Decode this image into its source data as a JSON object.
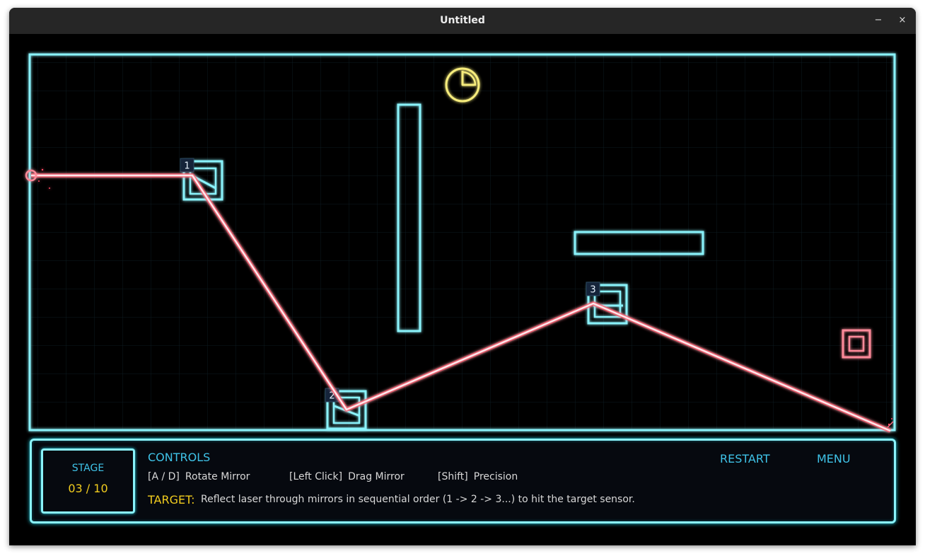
{
  "window": {
    "title": "Untitled",
    "minimize_label": "−",
    "close_label": "×"
  },
  "mirrors": [
    {
      "label": "1"
    },
    {
      "label": "2"
    },
    {
      "label": "3"
    }
  ],
  "hud": {
    "stage_label": "STAGE",
    "stage_value": "03 / 10",
    "controls_title": "CONTROLS",
    "controls": [
      {
        "key": "[A / D]",
        "action": "Rotate Mirror"
      },
      {
        "key": "[Left Click]",
        "action": "Drag Mirror"
      },
      {
        "key": "[Shift]",
        "action": "Precision"
      }
    ],
    "target_label": "TARGET:",
    "target_text": "Reflect laser through mirrors in sequential order (1 -> 2 -> 3...) to hit the target sensor.",
    "restart_label": "RESTART",
    "menu_label": "MENU"
  },
  "colors": {
    "neon_cyan": "#8af3fb",
    "laser": "#ffe6ea",
    "laser_glow": "#ff4a63",
    "timer": "#f6ec7c",
    "hud_text": "#3fc3e8",
    "hud_accent": "#f2cd1e"
  },
  "icons": {
    "timer": "clock-icon",
    "emitter": "laser-emitter-icon",
    "target": "target-sensor-icon"
  }
}
